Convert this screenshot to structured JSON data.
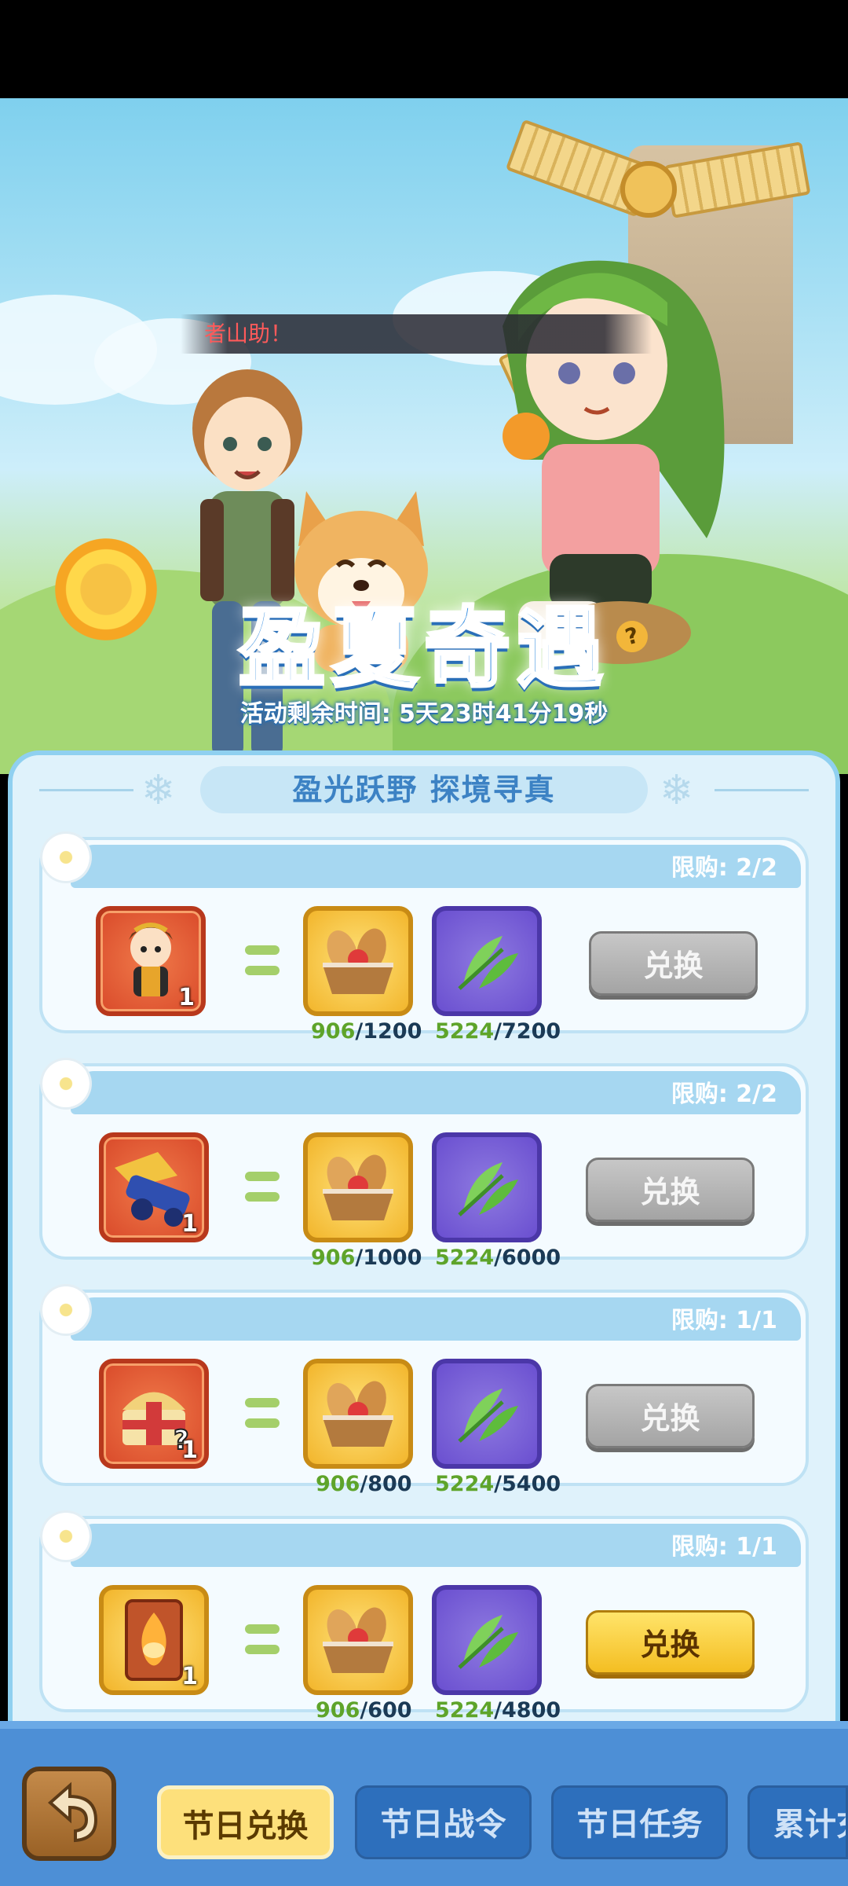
{
  "banner": {
    "scroll_message": "者山助！",
    "title": "盈夏奇遇",
    "help_icon": "?",
    "timer": "活动剩余时间: 5天23时41分19秒"
  },
  "panel": {
    "header": "盈光跃野 探境寻真",
    "exchange_label": "兑换",
    "items": [
      {
        "limit": "限购: 2/2",
        "reward": "hero-monkey-king",
        "reward_qty": "1",
        "bread_have": "906",
        "bread_need": "/1200",
        "leaf_have": "5224",
        "leaf_need": "/7200",
        "button_state": "disabled"
      },
      {
        "limit": "限购: 2/2",
        "reward": "golden-cannon",
        "reward_qty": "1",
        "bread_have": "906",
        "bread_need": "/1000",
        "leaf_have": "5224",
        "leaf_need": "/6000",
        "button_state": "disabled"
      },
      {
        "limit": "限购: 1/1",
        "reward": "mystery-chest",
        "reward_qty": "1",
        "bread_have": "906",
        "bread_need": "/800",
        "leaf_have": "5224",
        "leaf_need": "/5400",
        "button_state": "disabled"
      },
      {
        "limit": "限购: 1/1",
        "reward": "flame-scroll-card",
        "reward_qty": "1",
        "bread_have": "906",
        "bread_need": "/600",
        "leaf_have": "5224",
        "leaf_need": "/4800",
        "button_state": "enabled"
      }
    ]
  },
  "tabs": [
    {
      "label": "节日兑换",
      "active": true
    },
    {
      "label": "节日战令",
      "active": false
    },
    {
      "label": "节日任务",
      "active": false
    },
    {
      "label": "累计充",
      "active": false
    }
  ],
  "colors": {
    "accent_blue": "#3a8fe0",
    "count_green": "#5ea42a",
    "active_tab": "#fde07b"
  }
}
